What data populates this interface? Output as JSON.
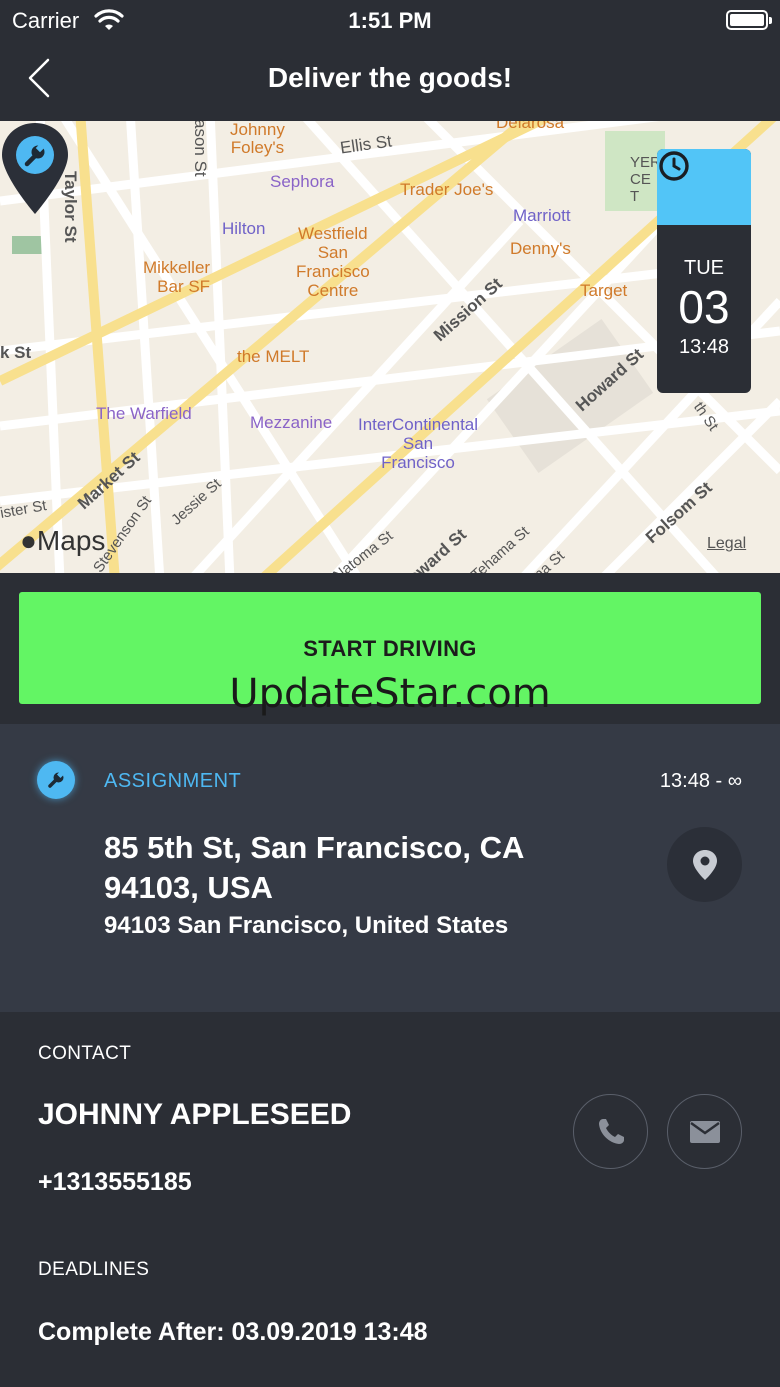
{
  "status_bar": {
    "carrier": "Carrier",
    "time": "1:51 PM"
  },
  "nav": {
    "title": "Deliver the goods!",
    "back_icon": "chevron-left-icon"
  },
  "map": {
    "labels": {
      "taylor": "Taylor St",
      "mason": "ason St",
      "johnny_foleys": "Johnny\nFoley's",
      "ellis": "Ellis St",
      "delarosa": "Delarosa",
      "sephora": "Sephora",
      "trader_joes": "Trader Joe's",
      "hilton": "Hilton",
      "marriott": "Marriott",
      "yerba": "YER\nCE\nT",
      "westfield": "Westfield\nSan\nFrancisco\nCentre",
      "dennys": "Denny's",
      "mikkeller": "Mikkeller\nBar SF",
      "target": "Target",
      "mission": "Mission St",
      "ok_st": "k St",
      "the_melt": "the MELT",
      "howard": "Howard St",
      "warfield": "The Warfield",
      "mezzanine": "Mezzanine",
      "intercontinental": "InterContinental\nSan\nFrancisco",
      "market": "Market St",
      "jessie": "Jessie St",
      "stevenson": "Stevenson St",
      "ister": "ister St",
      "natoma": "Natoma St",
      "howard2": "oward St",
      "tehama": "Tehama St",
      "clementina": "ina St",
      "folsom": "Folsom St",
      "fourth": "th St",
      "maps": "Maps",
      "legal": "Legal"
    }
  },
  "date_card": {
    "weekday": "TUE",
    "day": "03",
    "time": "13:48",
    "icon": "clock-icon"
  },
  "start_button": {
    "label": "START DRIVING"
  },
  "watermark": "UpdateStar.com",
  "assignment": {
    "label": "ASSIGNMENT",
    "time_range": "13:48 - ∞",
    "address": "85 5th St, San Francisco, CA 94103, USA",
    "city_line": "94103 San Francisco, United States",
    "icon": "wrench-icon"
  },
  "contact": {
    "section_label": "CONTACT",
    "name": "JOHNNY APPLESEED",
    "phone": "+1313555185"
  },
  "deadlines": {
    "section_label": "DEADLINES",
    "complete_after": "Complete After: 03.09.2019 13:48"
  },
  "colors": {
    "background": "#2b2e35",
    "panel": "#353a45",
    "accent_blue": "#4eb8f2",
    "start_green": "#63f564"
  }
}
